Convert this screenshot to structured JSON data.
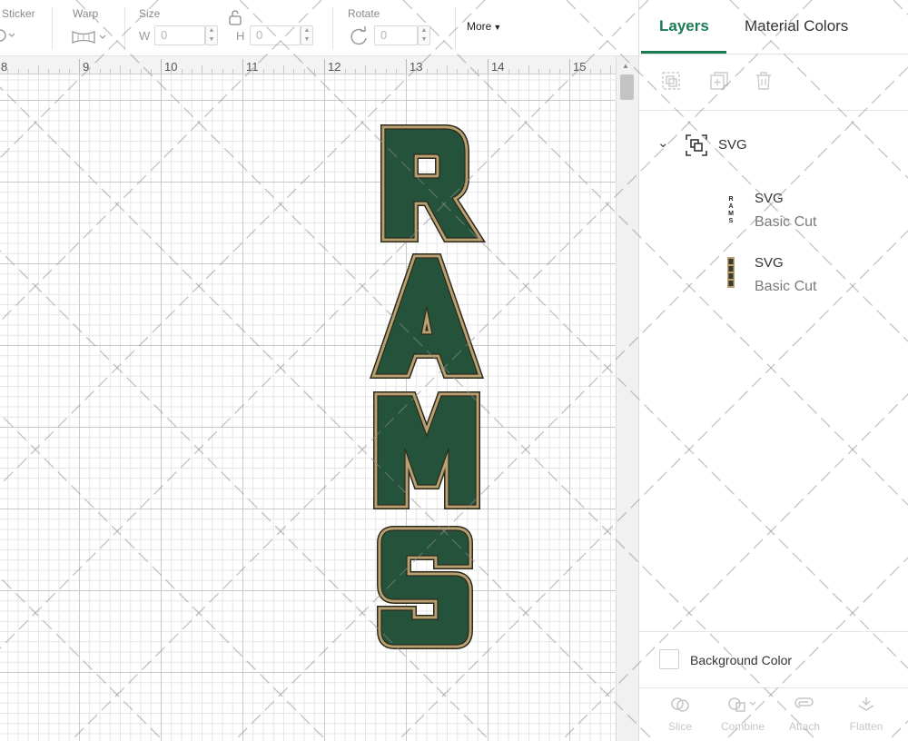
{
  "toolbar": {
    "sticker_label": "Sticker",
    "warp_label": "Warp",
    "size_label": "Size",
    "width_label": "W",
    "width_value": "0",
    "height_label": "H",
    "height_value": "0",
    "rotate_label": "Rotate",
    "rotate_value": "0",
    "more_label": "More"
  },
  "ruler": {
    "ticks": [
      "8",
      "9",
      "10",
      "11",
      "12",
      "13",
      "14",
      "15"
    ]
  },
  "artwork": {
    "letters": [
      "R",
      "A",
      "M",
      "S"
    ],
    "fill_color": "#24523a",
    "outline_color": "#b7a172",
    "edge_color": "#2e2a1c"
  },
  "panel": {
    "tabs": {
      "layers": "Layers",
      "material_colors": "Material Colors"
    },
    "layer_actions": [
      "group-icon",
      "duplicate-icon",
      "delete-icon"
    ],
    "group": {
      "name": "SVG",
      "icon": "group-icon",
      "layers": [
        {
          "name": "SVG",
          "operation": "Basic Cut"
        },
        {
          "name": "SVG",
          "operation": "Basic Cut"
        }
      ]
    },
    "background_color_label": "Background Color",
    "bottom_actions": [
      {
        "label": "Slice",
        "icon": "slice-icon"
      },
      {
        "label": "Combine",
        "icon": "combine-icon"
      },
      {
        "label": "Attach",
        "icon": "attach-icon"
      },
      {
        "label": "Flatten",
        "icon": "flatten-icon"
      }
    ]
  },
  "colors": {
    "accent": "#1c7a55",
    "grid_major": "#c9c9c9",
    "grid_minor": "#e6e6e6"
  }
}
